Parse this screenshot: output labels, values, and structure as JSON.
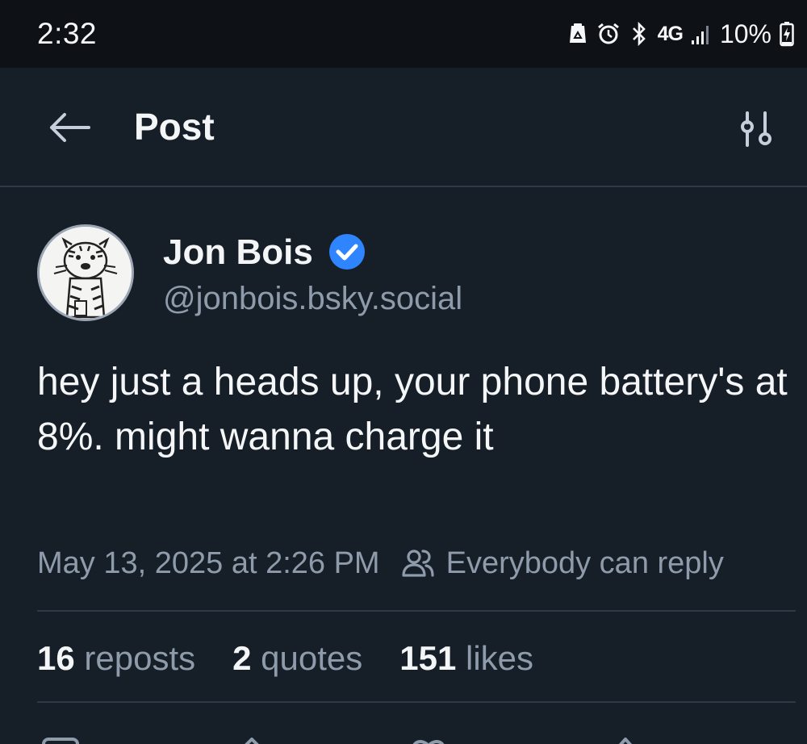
{
  "status_bar": {
    "time": "2:32",
    "network": "4G",
    "battery": "10%",
    "icons": [
      "recycle-icon",
      "alarm-icon",
      "bluetooth-icon",
      "network-4g-icon",
      "signal-icon",
      "battery-charging-icon"
    ]
  },
  "header": {
    "title": "Post",
    "back_icon": "arrow-left-icon",
    "filter_icon": "sliders-icon"
  },
  "post": {
    "author": {
      "display_name": "Jon Bois",
      "handle": "@jonbois.bsky.social",
      "verified": true
    },
    "text": "hey just a heads up, your phone battery's at 8%. might wanna charge it",
    "date": "May 13, 2025 at 2:26 PM",
    "reply_setting": "Everybody can reply",
    "stats": {
      "reposts_count": "16",
      "reposts_label": "reposts",
      "quotes_count": "2",
      "quotes_label": "quotes",
      "likes_count": "151",
      "likes_label": "likes"
    }
  },
  "actions": [
    "reply-icon",
    "repost-icon",
    "like-icon",
    "share-icon"
  ],
  "colors": {
    "background": "#161e27",
    "status_bar": "#0e1217",
    "text_primary": "#f3f5f7",
    "text_muted": "#8e9bab",
    "divider": "#2e3a48",
    "verified": "#2f85ff"
  }
}
